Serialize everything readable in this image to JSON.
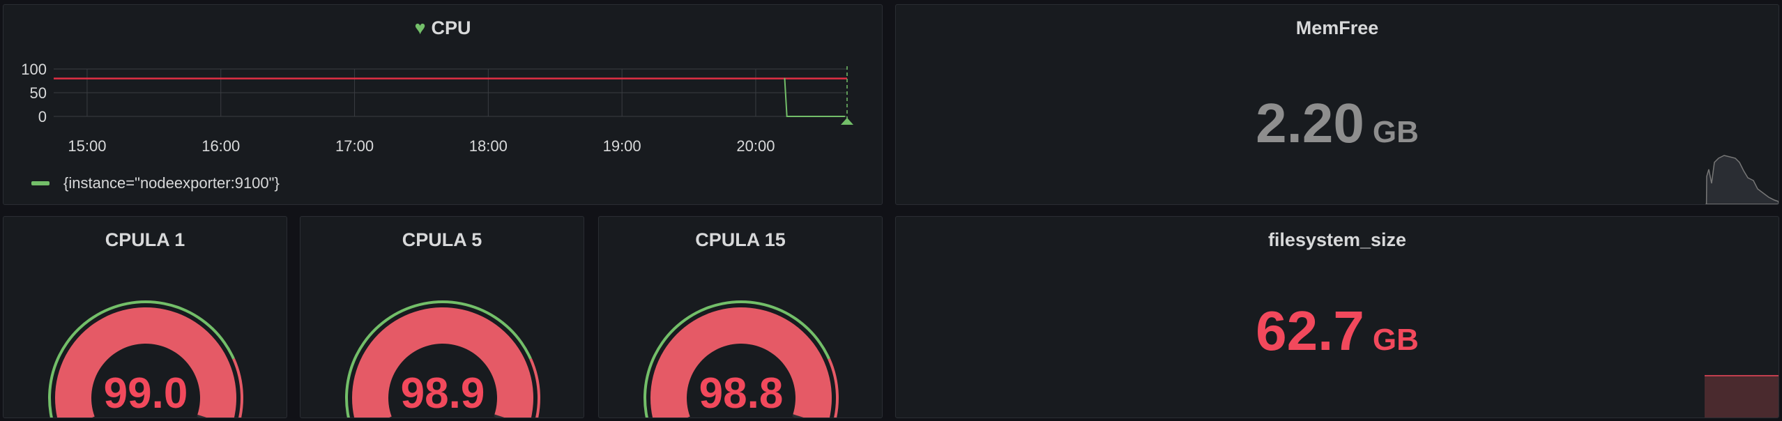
{
  "cpu_panel": {
    "title": "CPU",
    "legend_label": "{instance=\"nodeexporter:9100\"}",
    "colors": {
      "series": "#73bf69",
      "threshold": "#e02f44",
      "grid": "#3a3d42"
    }
  },
  "memfree_panel": {
    "title": "MemFree",
    "value": "2.20",
    "unit": "GB",
    "color": "#8e8e8e"
  },
  "filesystem_panel": {
    "title": "filesystem_size",
    "value": "62.7",
    "unit": "GB",
    "color": "#f2495c"
  },
  "gauges": [
    {
      "title": "CPULA 1",
      "value": "99.0",
      "level": 0.99
    },
    {
      "title": "CPULA 5",
      "value": "98.9",
      "level": 0.989
    },
    {
      "title": "CPULA 15",
      "value": "98.8",
      "level": 0.988
    }
  ],
  "chart_data": {
    "type": "line",
    "title": "CPU",
    "x_ticks": [
      "15:00",
      "16:00",
      "17:00",
      "18:00",
      "19:00",
      "20:00"
    ],
    "y_ticks": [
      100,
      50,
      0
    ],
    "ylim": [
      0,
      100
    ],
    "series": [
      {
        "name": "{instance=\"nodeexporter:9100\"}",
        "x": [
          "20:13",
          "20:14",
          "20:40"
        ],
        "values": [
          80,
          0,
          0
        ]
      }
    ],
    "threshold": 80,
    "grid": true,
    "legend": "bottom-left"
  }
}
